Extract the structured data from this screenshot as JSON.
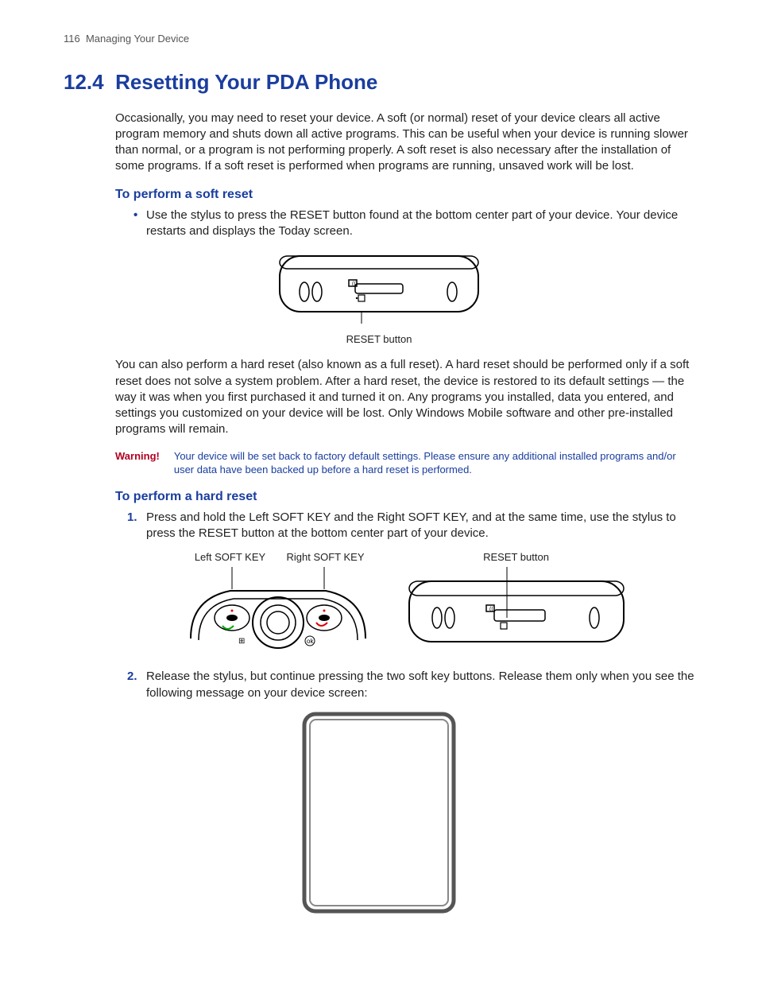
{
  "header": {
    "page_number": "116",
    "running_title": "Managing Your Device"
  },
  "section": {
    "number": "12.4",
    "title": "Resetting Your PDA Phone"
  },
  "intro": "Occasionally, you may need to reset your device. A soft (or normal) reset of your device clears all active program memory and shuts down all active programs. This can be useful when your device is running slower than normal, or a program is not performing properly. A soft reset is also necessary after the installation of some programs. If a soft reset is performed when programs are running, unsaved work will be lost.",
  "soft_reset": {
    "heading": "To perform a soft reset",
    "bullet": "Use the stylus to press the RESET button found at the bottom center part of your device. Your device restarts and displays the Today screen.",
    "fig_caption": "RESET button"
  },
  "mid_para": "You can also perform a hard reset (also known as a full reset). A hard reset should be performed only if a soft reset does not solve a system problem. After a hard reset, the device is restored to its default settings — the way it was when you first purchased it and turned it on. Any programs you installed, data you entered, and settings you customized on your device will be lost. Only Windows Mobile software and other pre-installed programs will remain.",
  "warning": {
    "label": "Warning!",
    "text": "Your device will be set back to factory default settings. Please ensure any additional installed programs and/or user data have been backed up before a hard reset is performed."
  },
  "hard_reset": {
    "heading": "To perform a hard reset",
    "step1": "Press and hold the Left SOFT KEY and the Right SOFT KEY, and at the same time, use the stylus to press the RESET button at the bottom center part of your device.",
    "labels": {
      "left": "Left SOFT KEY",
      "right": "Right SOFT KEY",
      "reset": "RESET button"
    },
    "step2": "Release the stylus, but continue pressing the two soft key buttons. Release them only when you see the following message on your device screen:"
  }
}
